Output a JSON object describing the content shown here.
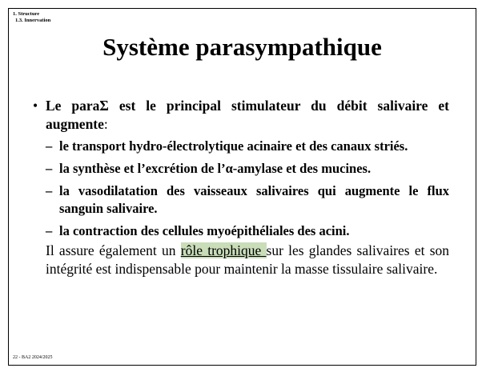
{
  "breadcrumb": {
    "section": "1. Structure",
    "subsection": "1.3. Innervation"
  },
  "title": "Système parasympathique",
  "bullet": {
    "mark": "•",
    "text_bold": "Le paraΣ est le principal stimulateur du débit salivaire et augmente",
    "text_colon": ":"
  },
  "sub_items": [
    {
      "dash": "–",
      "text": "le transport hydro-électrolytique acinaire et des canaux striés."
    },
    {
      "dash": "–",
      "text": "la synthèse et l’excrétion de l’α-amylase et des mucines."
    },
    {
      "dash": "–",
      "text": "la vasodilatation des vaisseaux salivaires qui augmente le flux sanguin salivaire."
    },
    {
      "dash": "–",
      "text": "la contraction des cellules myoépithéliales des acini."
    }
  ],
  "paragraph": {
    "before": "Il assure également un ",
    "highlight": "rôle trophique ",
    "after": "sur les glandes salivaires et son intégrité est indispensable pour maintenir la masse tissulaire salivaire."
  },
  "footer": "22 - BA2 2024/2025",
  "colors": {
    "highlight": "#c9ddb9",
    "text": "#000000",
    "border": "#000000"
  }
}
